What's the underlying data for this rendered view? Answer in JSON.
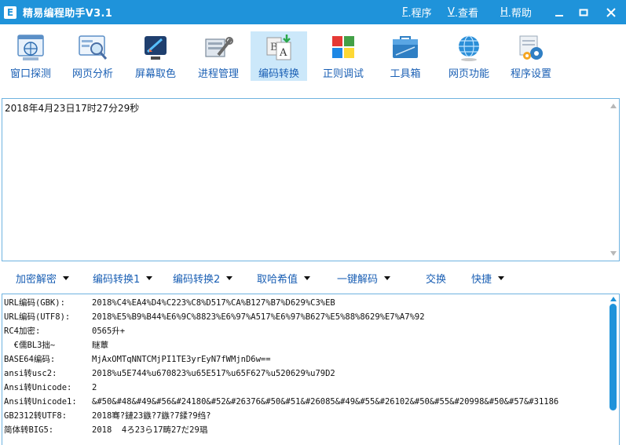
{
  "app": {
    "title": "精易编程助手V3.1",
    "icon_letter": "E"
  },
  "menu": [
    {
      "key": "F",
      "label": ".程序"
    },
    {
      "key": "V",
      "label": ".查看"
    },
    {
      "key": "H",
      "label": ".帮助"
    }
  ],
  "window_buttons": [
    "minimize-icon",
    "maximize-icon",
    "close-icon"
  ],
  "toolbar": [
    {
      "label": "窗口探测",
      "icon": "window-probe-icon"
    },
    {
      "label": "网页分析",
      "icon": "web-analysis-icon"
    },
    {
      "label": "屏幕取色",
      "icon": "color-picker-icon"
    },
    {
      "label": "进程管理",
      "icon": "process-manager-icon"
    },
    {
      "label": "编码转换",
      "icon": "encoding-convert-icon",
      "active": true
    },
    {
      "label": "正则调试",
      "icon": "regex-debug-icon"
    },
    {
      "label": "工具箱",
      "icon": "toolbox-icon"
    },
    {
      "label": "网页功能",
      "icon": "web-function-icon"
    },
    {
      "label": "程序设置",
      "icon": "settings-icon"
    }
  ],
  "input_text": "2018年4月23日17时27分29秒",
  "function_bar": [
    {
      "label": "加密解密",
      "dropdown": true
    },
    {
      "label": "编码转换1",
      "dropdown": true
    },
    {
      "label": "编码转换2",
      "dropdown": true
    },
    {
      "label": "取哈希值",
      "dropdown": true
    },
    {
      "label": "一键解码",
      "dropdown": true
    },
    {
      "label": "交换",
      "dropdown": false
    },
    {
      "label": "快捷",
      "dropdown": true
    }
  ],
  "results": [
    {
      "key": "URL编码(GBK):",
      "value": "2018%C4%EA4%D4%C223%C8%D517%CA%B127%B7%D629%C3%EB"
    },
    {
      "key": "URL编码(UTF8):",
      "value": "2018%E5%B9%B44%E6%9C%8823%E6%97%A517%E6%97%B627%E5%88%8629%E7%A7%92"
    },
    {
      "key": "RC4加密:",
      "value": "0565升+"
    },
    {
      "key": "  €儒BL3拙~",
      "value": "瞇蕈"
    },
    {
      "key": "BASE64编码:",
      "value": "MjAxOMTqNNTCMjPI1TE3yrEyN7fWMjnD6w=="
    },
    {
      "key": "ansi转usc2:",
      "value": "2018%u5E744%u670823%u65E517%u65F627%u520629%u79D2"
    },
    {
      "key": "Ansi转Unicode:",
      "value": "2"
    },
    {
      "key": "Ansi转Unicode1:",
      "value": "&#50&#48&#49&#56&#24180&#52&#26376&#50&#51&#26085&#49&#55&#26102&#50&#55&#20998&#50&#57&#31186"
    },
    {
      "key": "GB2312转UTF8:",
      "value": "2018骞?鏈23鏃?7鏃?7鍒?9绉?"
    },
    {
      "key": "简体转BIG5:",
      "value": "2018  4ろ23ら17畴27だ29琩"
    }
  ]
}
